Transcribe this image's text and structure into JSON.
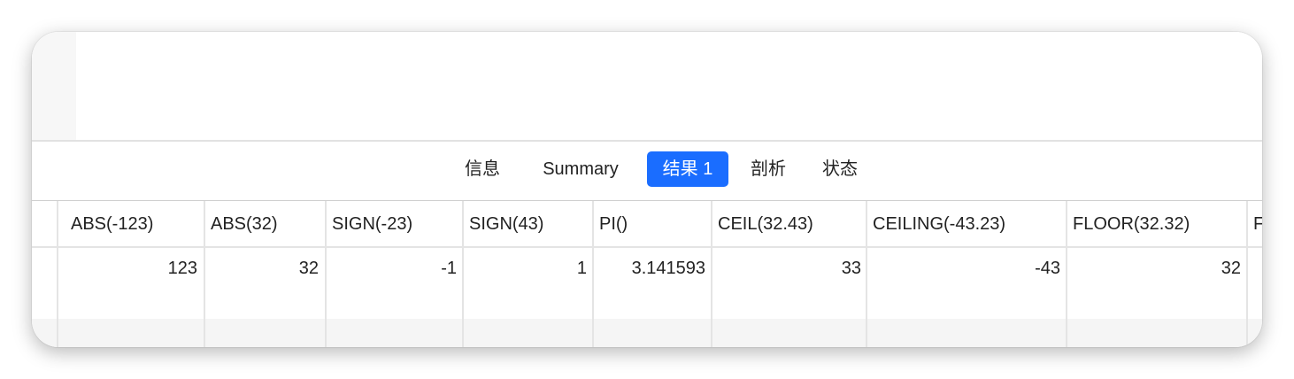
{
  "tabs": [
    {
      "label": "信息",
      "active": false
    },
    {
      "label": "Summary",
      "active": false
    },
    {
      "label": "结果 1",
      "active": true
    },
    {
      "label": "剖析",
      "active": false
    },
    {
      "label": "状态",
      "active": false
    }
  ],
  "colors": {
    "accent": "#1a6dff"
  },
  "columns": [
    "ABS(-123)",
    "ABS(32)",
    "SIGN(-23)",
    "SIGN(43)",
    "PI()",
    "CEIL(32.43)",
    "CEILING(-43.23)",
    "FLOOR(32.32)",
    "F"
  ],
  "rows": [
    [
      "123",
      "32",
      "-1",
      "1",
      "3.141593",
      "33",
      "-43",
      "32",
      ""
    ]
  ]
}
